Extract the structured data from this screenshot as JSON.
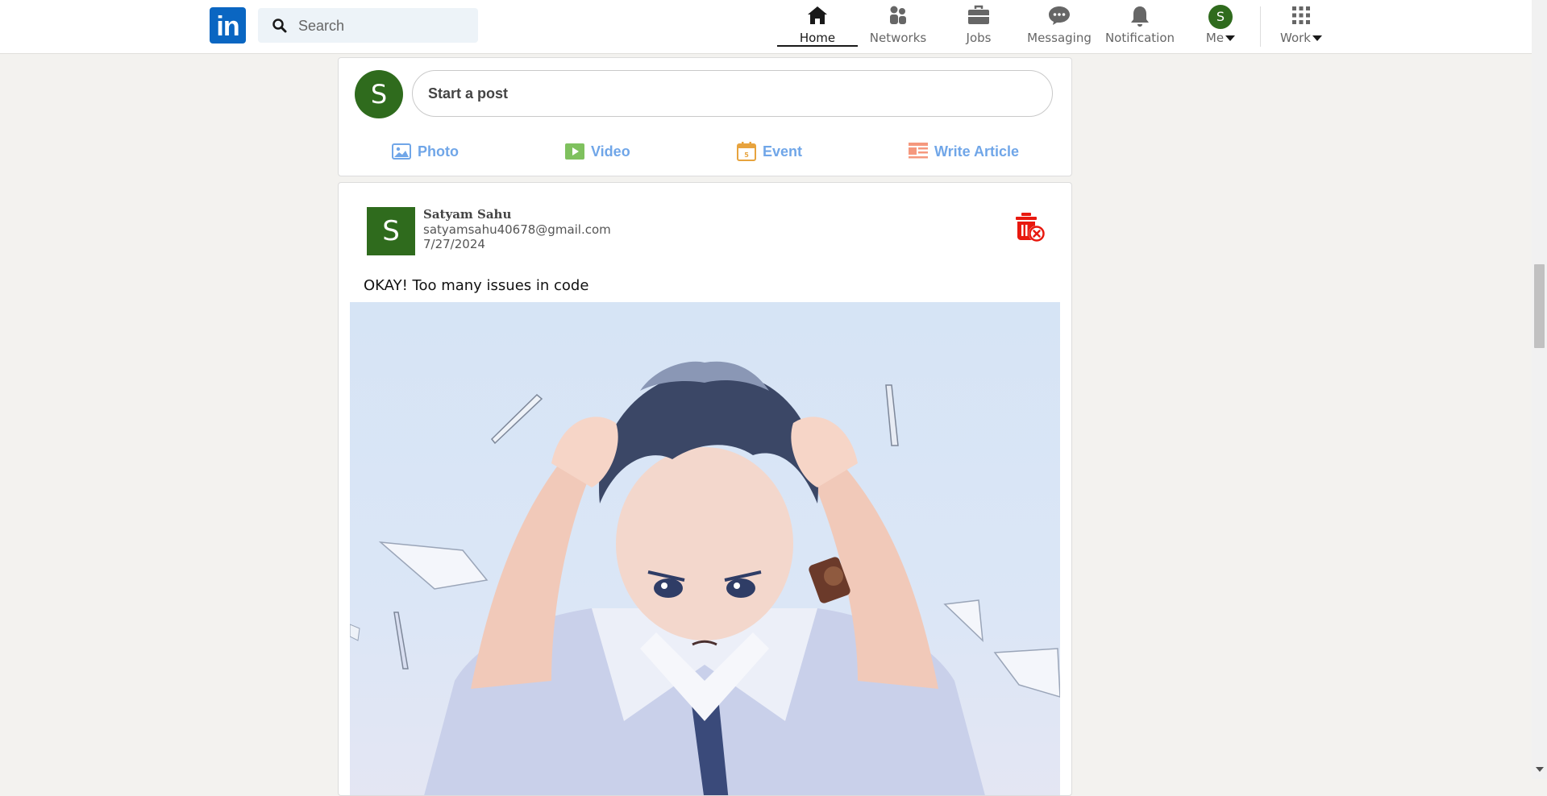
{
  "nav": {
    "logo_text": "in",
    "search_placeholder": "Search",
    "items": [
      {
        "label": "Home",
        "icon": "home-icon",
        "active": true
      },
      {
        "label": "Networks",
        "icon": "people-icon"
      },
      {
        "label": "Jobs",
        "icon": "briefcase-icon"
      },
      {
        "label": "Messaging",
        "icon": "chat-bubble-icon"
      },
      {
        "label": "Notification",
        "icon": "bell-icon"
      },
      {
        "label": "Me",
        "icon": "user-avatar"
      },
      {
        "label": "Work",
        "icon": "grid-icon"
      }
    ],
    "me_avatar_letter": "S"
  },
  "compose": {
    "avatar_letter": "S",
    "placeholder": "Start a post",
    "actions": [
      {
        "label": "Photo",
        "icon": "photo-icon",
        "color": "#70a6e8"
      },
      {
        "label": "Video",
        "icon": "video-icon",
        "color": "#7fc15e"
      },
      {
        "label": "Event",
        "icon": "calendar-icon",
        "color": "#e7a33e"
      },
      {
        "label": "Write Article",
        "icon": "article-icon",
        "color": "#f5987e"
      }
    ]
  },
  "post": {
    "avatar_letter": "S",
    "author_name": "Satyam Sahu",
    "author_email": "satyamsahu40678@gmail.com",
    "date": "7/27/2024",
    "text": "OKAY! Too many issues in code",
    "image_description_icon": "anime-boy-stressed-image",
    "delete_icon": "delete-post-icon"
  },
  "colors": {
    "brand": "#0a66c2",
    "avatar_green": "#2f6b1d",
    "action_blue": "#70a6e8",
    "delete_red": "#e8190f"
  }
}
